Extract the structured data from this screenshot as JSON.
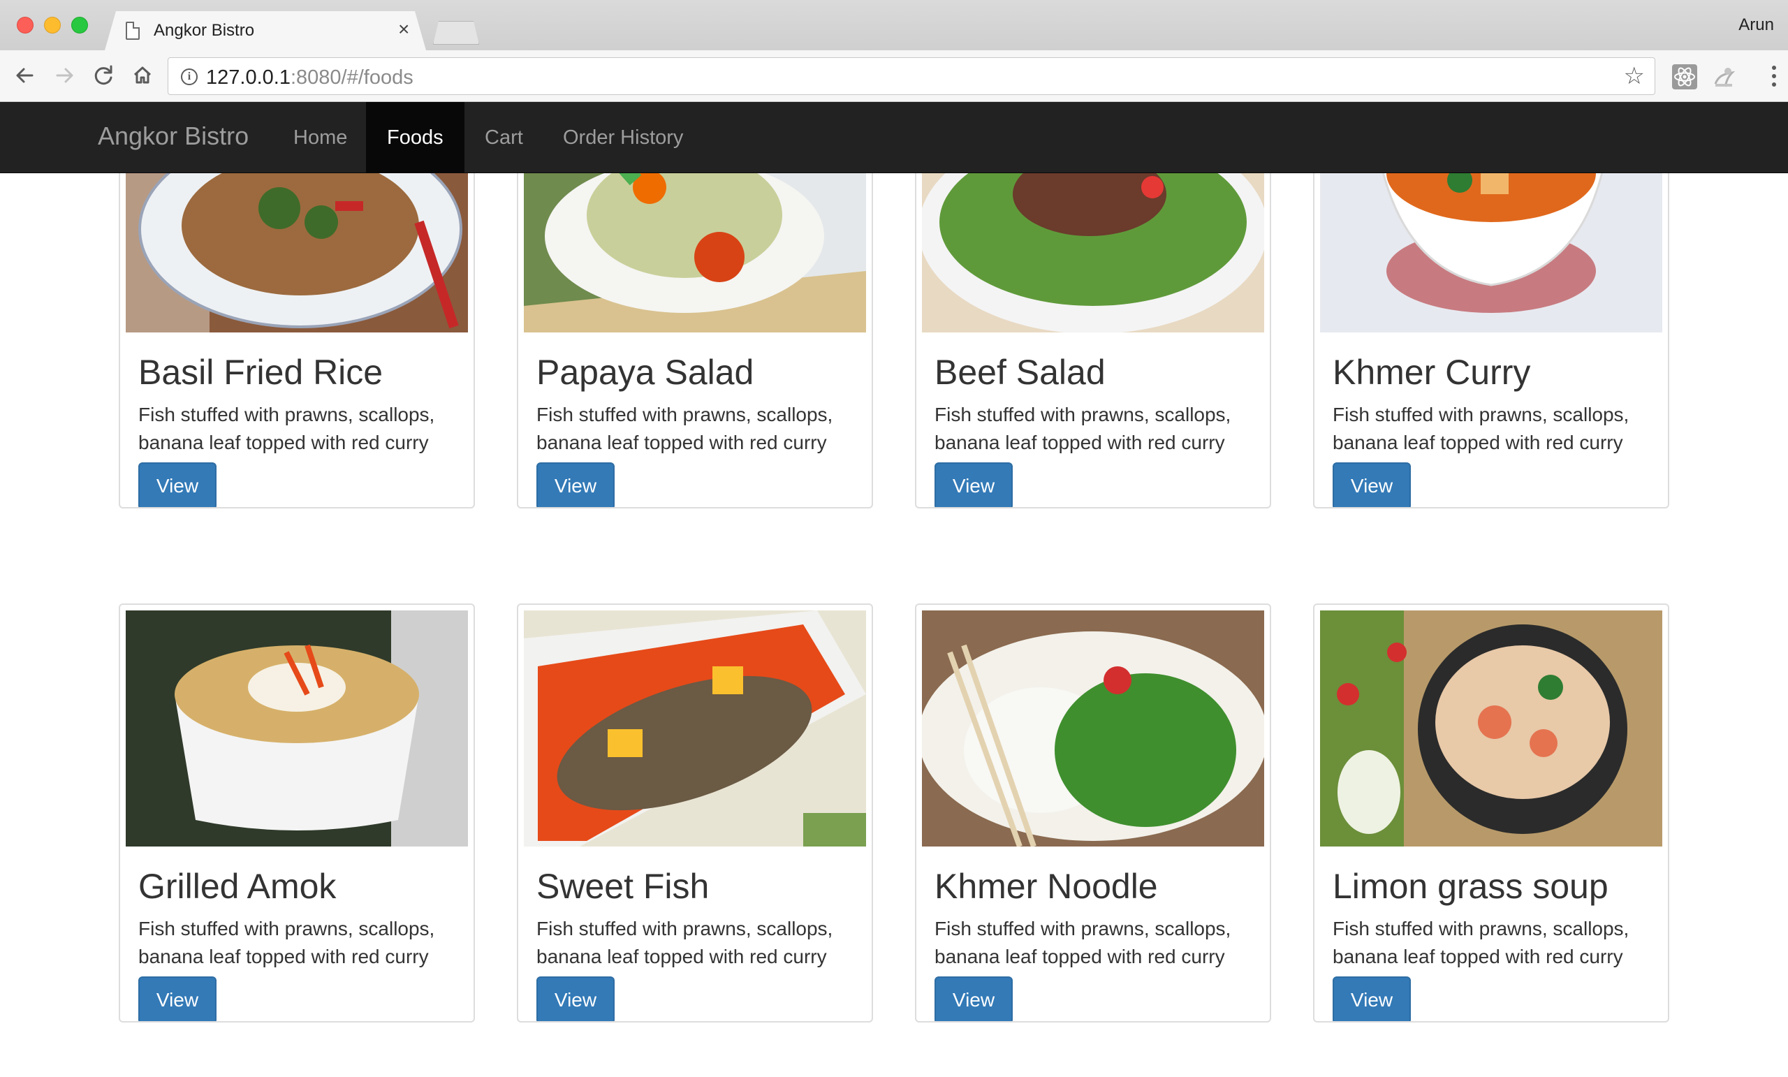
{
  "browser": {
    "tab_title": "Angkor Bistro",
    "tab_close": "×",
    "profile": "Arun",
    "url_host": "127.0.0.1",
    "url_rest": ":8080/#/foods"
  },
  "navbar": {
    "brand": "Angkor Bistro",
    "items": [
      "Home",
      "Foods",
      "Cart",
      "Order History"
    ],
    "active": "Foods"
  },
  "foods": [
    {
      "name": "Basil Fried Rice",
      "description": "Fish stuffed with prawns, scallops, banana leaf topped with red curry",
      "button": "View"
    },
    {
      "name": "Papaya Salad",
      "description": "Fish stuffed with prawns, scallops, banana leaf topped with red curry",
      "button": "View"
    },
    {
      "name": "Beef Salad",
      "description": "Fish stuffed with prawns, scallops, banana leaf topped with red curry",
      "button": "View"
    },
    {
      "name": "Khmer Curry",
      "description": "Fish stuffed with prawns, scallops, banana leaf topped with red curry",
      "button": "View"
    },
    {
      "name": "Grilled Amok",
      "description": "Fish stuffed with prawns, scallops, banana leaf topped with red curry",
      "button": "View"
    },
    {
      "name": "Sweet Fish",
      "description": "Fish stuffed with prawns, scallops, banana leaf topped with red curry",
      "button": "View"
    },
    {
      "name": "Khmer Noodle",
      "description": "Fish stuffed with prawns, scallops, banana leaf topped with red curry",
      "button": "View"
    },
    {
      "name": "Limon grass soup",
      "description": "Fish stuffed with prawns, scallops, banana leaf topped with red curry",
      "button": "View"
    }
  ],
  "colors": {
    "navbar_bg": "#222222",
    "button_primary": "#337ab7"
  }
}
